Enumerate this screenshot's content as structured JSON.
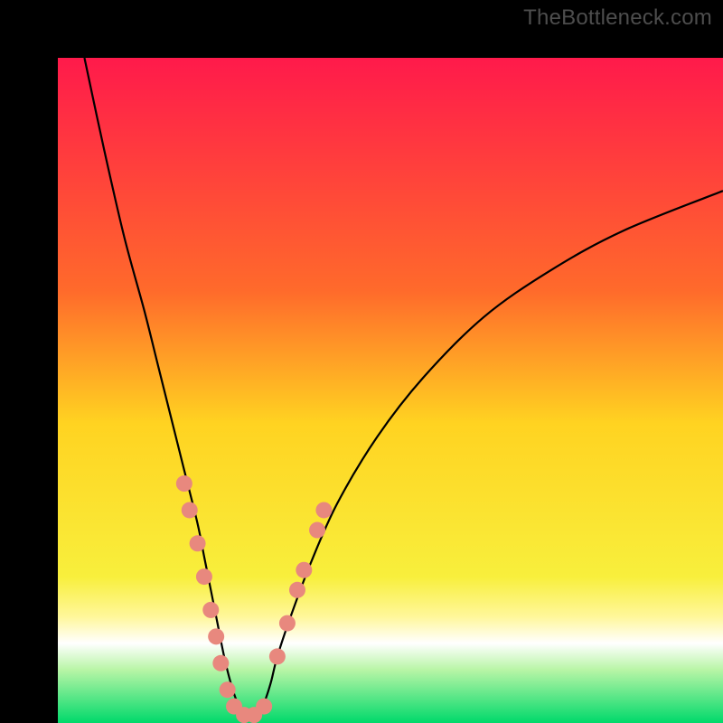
{
  "watermark": "TheBottleneck.com",
  "chart_data": {
    "type": "line",
    "title": "",
    "xlabel": "",
    "ylabel": "",
    "xlim": [
      0,
      100
    ],
    "ylim": [
      0,
      100
    ],
    "gradient_stops": [
      {
        "offset": 0,
        "color": "#ff1a4b"
      },
      {
        "offset": 35,
        "color": "#ff6a2b"
      },
      {
        "offset": 55,
        "color": "#ffd321"
      },
      {
        "offset": 78,
        "color": "#f8ef3c"
      },
      {
        "offset": 84,
        "color": "#fff79a"
      },
      {
        "offset": 88,
        "color": "#ffffff"
      },
      {
        "offset": 92,
        "color": "#b8f5a6"
      },
      {
        "offset": 100,
        "color": "#00d96b"
      }
    ],
    "series": [
      {
        "name": "left-curve",
        "x": [
          4,
          7,
          10,
          13,
          15,
          17,
          19,
          21,
          22,
          23,
          24,
          25,
          26,
          27,
          28
        ],
        "y": [
          100,
          86,
          73,
          62,
          54,
          46,
          38,
          30,
          25,
          20,
          15,
          10,
          6,
          3,
          1
        ]
      },
      {
        "name": "right-curve",
        "x": [
          30,
          31,
          32,
          33,
          35,
          38,
          42,
          48,
          55,
          64,
          74,
          85,
          100
        ],
        "y": [
          1,
          3,
          6,
          10,
          16,
          24,
          33,
          43,
          52,
          61,
          68,
          74,
          80
        ]
      }
    ],
    "highlight_points": {
      "color": "#e8887e",
      "radius_px": 9,
      "points": [
        {
          "x": 19.0,
          "y": 36
        },
        {
          "x": 19.8,
          "y": 32
        },
        {
          "x": 21.0,
          "y": 27
        },
        {
          "x": 22.0,
          "y": 22
        },
        {
          "x": 23.0,
          "y": 17
        },
        {
          "x": 23.8,
          "y": 13
        },
        {
          "x": 24.5,
          "y": 9
        },
        {
          "x": 25.5,
          "y": 5
        },
        {
          "x": 26.5,
          "y": 2.5
        },
        {
          "x": 28.0,
          "y": 1.2
        },
        {
          "x": 29.5,
          "y": 1.2
        },
        {
          "x": 31.0,
          "y": 2.5
        },
        {
          "x": 33.0,
          "y": 10
        },
        {
          "x": 34.5,
          "y": 15
        },
        {
          "x": 36.0,
          "y": 20
        },
        {
          "x": 37.0,
          "y": 23
        },
        {
          "x": 39.0,
          "y": 29
        },
        {
          "x": 40.0,
          "y": 32
        }
      ]
    }
  }
}
